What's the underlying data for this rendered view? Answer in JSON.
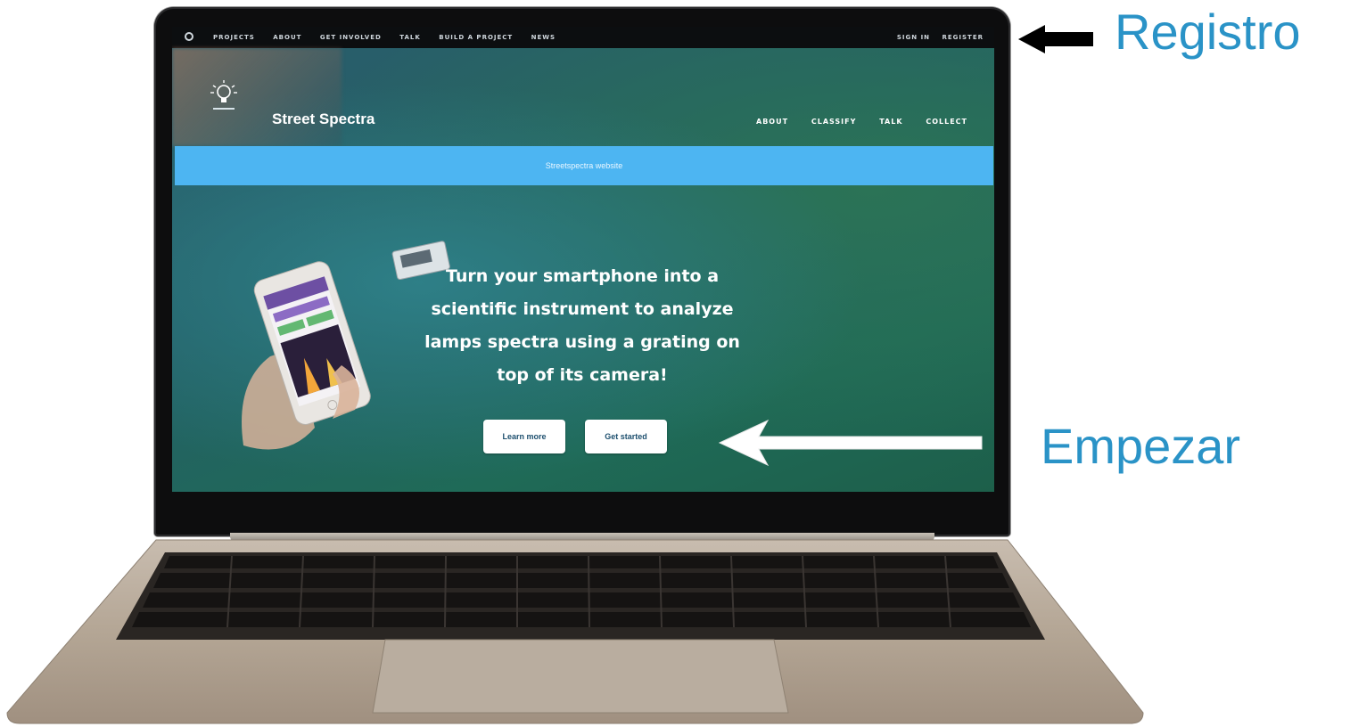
{
  "site": {
    "topbar": {
      "nav": [
        "PROJECTS",
        "ABOUT",
        "GET INVOLVED",
        "TALK",
        "BUILD A PROJECT",
        "NEWS"
      ],
      "sign_in": "SIGN IN",
      "register": "REGISTER"
    },
    "project": {
      "title": "Street Spectra",
      "nav": [
        "ABOUT",
        "CLASSIFY",
        "TALK",
        "COLLECT"
      ]
    },
    "banner": "Streetspectra website",
    "hero": {
      "lines": [
        "Turn your smartphone into a",
        "scientific instrument to analyze",
        "lamps spectra using a grating on",
        "top of its camera!"
      ],
      "learn_more": "Learn more",
      "get_started": "Get started"
    }
  },
  "annotations": {
    "registro": "Registro",
    "empezar": "Empezar"
  },
  "colors": {
    "annotation": "#2a93c7",
    "banner": "#4db5f2",
    "topbar": "#0c0e10"
  },
  "icons": [
    "zooniverse-logo-icon",
    "lightbulb-logo-icon",
    "arrow-left-icon"
  ]
}
